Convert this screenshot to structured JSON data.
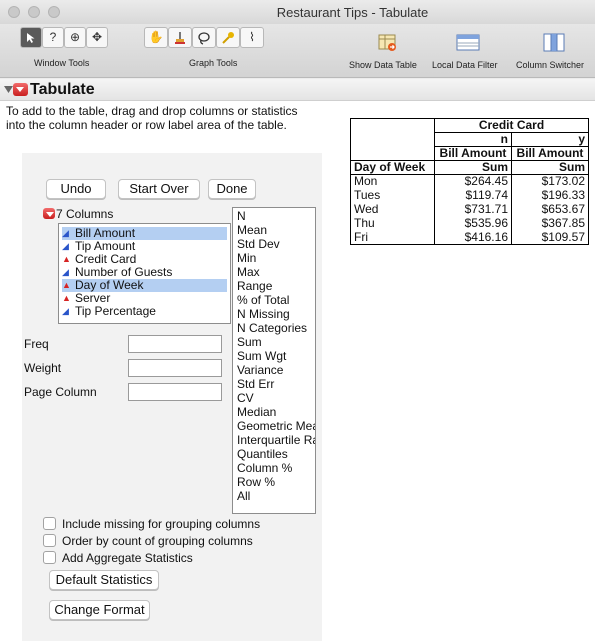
{
  "window": {
    "title": "Restaurant Tips - Tabulate"
  },
  "toolbar": {
    "window_tools_label": "Window Tools",
    "graph_tools_label": "Graph Tools",
    "buttons": [
      {
        "icon": "arrow-pointer-icon"
      },
      {
        "icon": "help-question-icon",
        "text": "?"
      },
      {
        "icon": "crosshair-icon",
        "text": "⊕"
      },
      {
        "icon": "move-arrows-icon",
        "text": "✥"
      },
      {
        "icon": "hand-grabber-icon",
        "text": "✋"
      },
      {
        "icon": "brush-icon"
      },
      {
        "icon": "lasso-icon"
      },
      {
        "icon": "annotate-pin-icon"
      },
      {
        "icon": "line-tool-icon",
        "text": "⌇"
      }
    ],
    "show_data_table": "Show Data Table",
    "local_data_filter": "Local Data Filter",
    "column_switcher": "Column Switcher"
  },
  "report": {
    "title": "Tabulate",
    "instructions": "To add to the table, drag and drop columns or statistics into the column header or row label area of the table.",
    "undo": "Undo",
    "start_over": "Start Over",
    "done": "Done",
    "columns_header": "7 Columns",
    "columns": [
      {
        "name": "Bill Amount",
        "type": "continuous",
        "selected": true
      },
      {
        "name": "Tip Amount",
        "type": "continuous",
        "selected": false
      },
      {
        "name": "Credit Card",
        "type": "nominal",
        "selected": false
      },
      {
        "name": "Number of Guests",
        "type": "continuous",
        "selected": false
      },
      {
        "name": "Day of Week",
        "type": "nominal",
        "selected": true
      },
      {
        "name": "Server",
        "type": "nominal",
        "selected": false
      },
      {
        "name": "Tip Percentage",
        "type": "continuous",
        "selected": false
      }
    ],
    "statistics": [
      "N",
      "Mean",
      "Std Dev",
      "Min",
      "Max",
      "Range",
      "% of Total",
      "N Missing",
      "N Categories",
      "Sum",
      "Sum Wgt",
      "Variance",
      "Std Err",
      "CV",
      "Median",
      "Geometric Mean",
      "Interquartile Range",
      "Quantiles",
      "Column %",
      "Row %",
      "All"
    ],
    "freq_label": "Freq",
    "weight_label": "Weight",
    "page_column_label": "Page Column",
    "freq_value": "",
    "weight_value": "",
    "page_column_value": "",
    "options": [
      {
        "label": "Include missing for grouping columns",
        "checked": false
      },
      {
        "label": "Order by count of grouping columns",
        "checked": false
      },
      {
        "label": "Add Aggregate Statistics",
        "checked": false
      }
    ],
    "default_statistics": "Default Statistics",
    "change_format": "Change Format"
  },
  "table": {
    "group_header": "Credit Card",
    "level_n": "n",
    "level_y": "y",
    "measure": "Bill Amount",
    "row_header": "Day of Week",
    "stat": "Sum",
    "rows": [
      {
        "day": "Mon",
        "n": "$264.45",
        "y": "$173.02"
      },
      {
        "day": "Tues",
        "n": "$119.74",
        "y": "$196.33"
      },
      {
        "day": "Wed",
        "n": "$731.71",
        "y": "$653.67"
      },
      {
        "day": "Thu",
        "n": "$535.96",
        "y": "$367.85"
      },
      {
        "day": "Fri",
        "n": "$416.16",
        "y": "$109.57"
      }
    ]
  }
}
